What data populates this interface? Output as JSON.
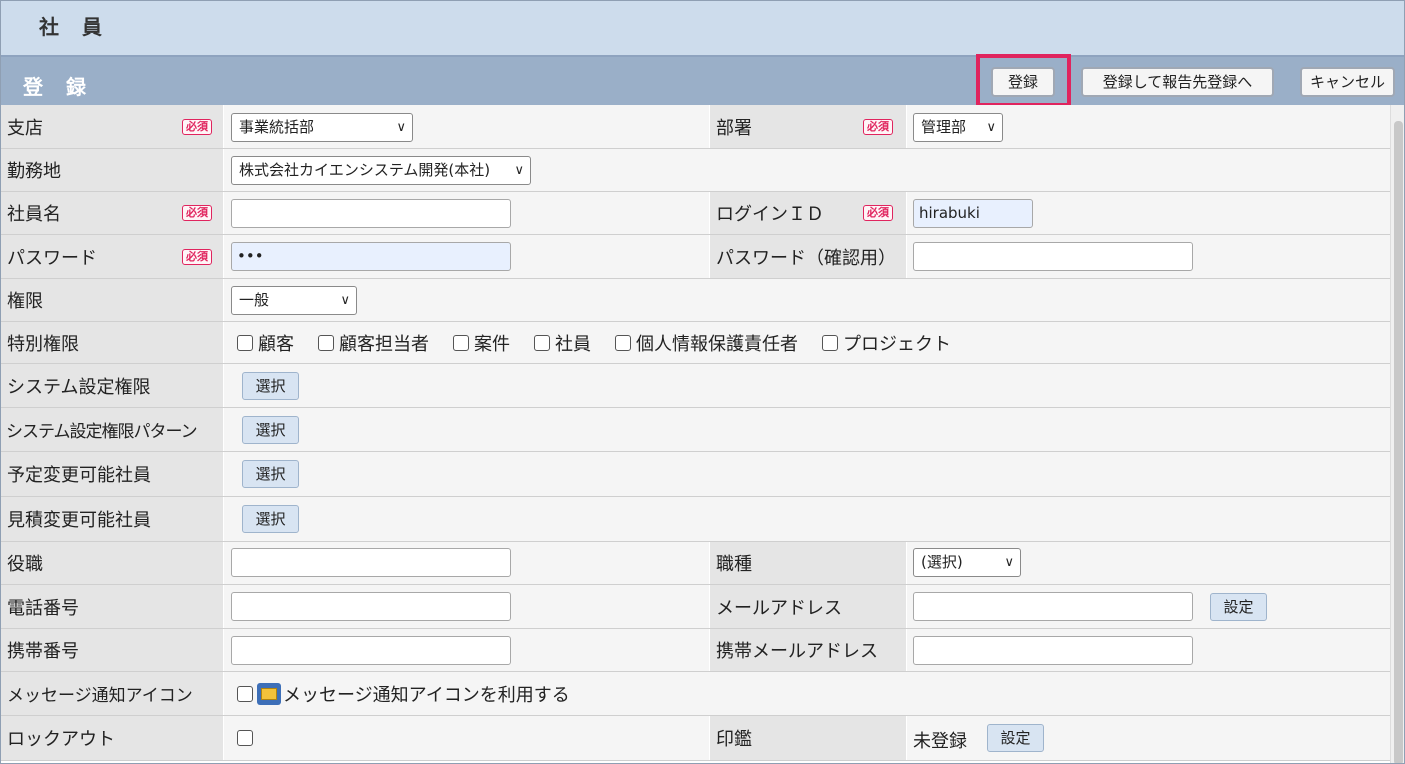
{
  "header": {
    "title": "社 員"
  },
  "subheader": {
    "title": "登 録"
  },
  "toolbar": {
    "register": "登録",
    "register_report": "登録して報告先登録へ",
    "cancel": "キャンセル"
  },
  "required_label": "必須",
  "fields": {
    "branch": {
      "label": "支店",
      "value": "事業統括部"
    },
    "department": {
      "label": "部署",
      "value": "管理部"
    },
    "workplace": {
      "label": "勤務地",
      "value": "株式会社カイエンシステム開発(本社)"
    },
    "employee_name": {
      "label": "社員名",
      "value": ""
    },
    "login_id": {
      "label": "ログインＩＤ",
      "value": "hirabuki"
    },
    "password": {
      "label": "パスワード",
      "value": "•••"
    },
    "password_confirm": {
      "label": "パスワード（確認用）",
      "value": ""
    },
    "authority": {
      "label": "権限",
      "value": "一般"
    },
    "special_authority": {
      "label": "特別権限",
      "options": [
        "顧客",
        "顧客担当者",
        "案件",
        "社員",
        "個人情報保護責任者",
        "プロジェクト"
      ]
    },
    "system_authority": {
      "label": "システム設定権限",
      "button": "選択"
    },
    "system_authority_pattern": {
      "label": "システム設定権限パターン",
      "button": "選択"
    },
    "schedule_editors": {
      "label": "予定変更可能社員",
      "button": "選択"
    },
    "estimate_editors": {
      "label": "見積変更可能社員",
      "button": "選択"
    },
    "position": {
      "label": "役職",
      "value": ""
    },
    "job_type": {
      "label": "職種",
      "value": "(選択)"
    },
    "phone": {
      "label": "電話番号",
      "value": ""
    },
    "email": {
      "label": "メールアドレス",
      "value": "",
      "button": "設定"
    },
    "mobile": {
      "label": "携帯番号",
      "value": ""
    },
    "mobile_email": {
      "label": "携帯メールアドレス",
      "value": ""
    },
    "message_icon": {
      "label": "メッセージ通知アイコン",
      "option": "メッセージ通知アイコンを利用する"
    },
    "lockout": {
      "label": "ロックアウト"
    },
    "seal": {
      "label": "印鑑",
      "status": "未登録",
      "button": "設定"
    }
  }
}
